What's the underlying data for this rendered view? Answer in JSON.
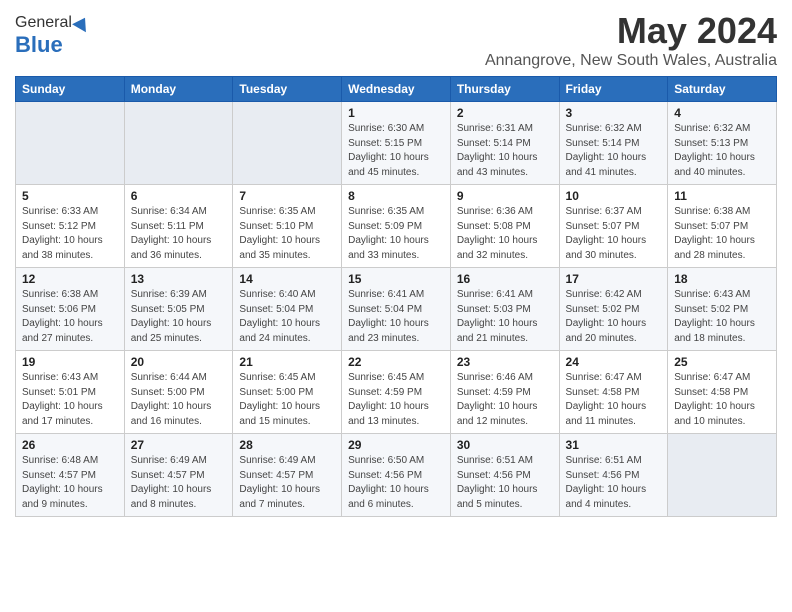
{
  "header": {
    "logo_line1": "General",
    "logo_line2": "Blue",
    "title": "May 2024",
    "subtitle": "Annangrove, New South Wales, Australia"
  },
  "days_of_week": [
    "Sunday",
    "Monday",
    "Tuesday",
    "Wednesday",
    "Thursday",
    "Friday",
    "Saturday"
  ],
  "weeks": [
    {
      "days": [
        {
          "num": "",
          "detail": "",
          "empty": true
        },
        {
          "num": "",
          "detail": "",
          "empty": true
        },
        {
          "num": "",
          "detail": "",
          "empty": true
        },
        {
          "num": "1",
          "detail": "Sunrise: 6:30 AM\nSunset: 5:15 PM\nDaylight: 10 hours\nand 45 minutes."
        },
        {
          "num": "2",
          "detail": "Sunrise: 6:31 AM\nSunset: 5:14 PM\nDaylight: 10 hours\nand 43 minutes."
        },
        {
          "num": "3",
          "detail": "Sunrise: 6:32 AM\nSunset: 5:14 PM\nDaylight: 10 hours\nand 41 minutes."
        },
        {
          "num": "4",
          "detail": "Sunrise: 6:32 AM\nSunset: 5:13 PM\nDaylight: 10 hours\nand 40 minutes."
        }
      ]
    },
    {
      "days": [
        {
          "num": "5",
          "detail": "Sunrise: 6:33 AM\nSunset: 5:12 PM\nDaylight: 10 hours\nand 38 minutes."
        },
        {
          "num": "6",
          "detail": "Sunrise: 6:34 AM\nSunset: 5:11 PM\nDaylight: 10 hours\nand 36 minutes."
        },
        {
          "num": "7",
          "detail": "Sunrise: 6:35 AM\nSunset: 5:10 PM\nDaylight: 10 hours\nand 35 minutes."
        },
        {
          "num": "8",
          "detail": "Sunrise: 6:35 AM\nSunset: 5:09 PM\nDaylight: 10 hours\nand 33 minutes."
        },
        {
          "num": "9",
          "detail": "Sunrise: 6:36 AM\nSunset: 5:08 PM\nDaylight: 10 hours\nand 32 minutes."
        },
        {
          "num": "10",
          "detail": "Sunrise: 6:37 AM\nSunset: 5:07 PM\nDaylight: 10 hours\nand 30 minutes."
        },
        {
          "num": "11",
          "detail": "Sunrise: 6:38 AM\nSunset: 5:07 PM\nDaylight: 10 hours\nand 28 minutes."
        }
      ]
    },
    {
      "days": [
        {
          "num": "12",
          "detail": "Sunrise: 6:38 AM\nSunset: 5:06 PM\nDaylight: 10 hours\nand 27 minutes."
        },
        {
          "num": "13",
          "detail": "Sunrise: 6:39 AM\nSunset: 5:05 PM\nDaylight: 10 hours\nand 25 minutes."
        },
        {
          "num": "14",
          "detail": "Sunrise: 6:40 AM\nSunset: 5:04 PM\nDaylight: 10 hours\nand 24 minutes."
        },
        {
          "num": "15",
          "detail": "Sunrise: 6:41 AM\nSunset: 5:04 PM\nDaylight: 10 hours\nand 23 minutes."
        },
        {
          "num": "16",
          "detail": "Sunrise: 6:41 AM\nSunset: 5:03 PM\nDaylight: 10 hours\nand 21 minutes."
        },
        {
          "num": "17",
          "detail": "Sunrise: 6:42 AM\nSunset: 5:02 PM\nDaylight: 10 hours\nand 20 minutes."
        },
        {
          "num": "18",
          "detail": "Sunrise: 6:43 AM\nSunset: 5:02 PM\nDaylight: 10 hours\nand 18 minutes."
        }
      ]
    },
    {
      "days": [
        {
          "num": "19",
          "detail": "Sunrise: 6:43 AM\nSunset: 5:01 PM\nDaylight: 10 hours\nand 17 minutes."
        },
        {
          "num": "20",
          "detail": "Sunrise: 6:44 AM\nSunset: 5:00 PM\nDaylight: 10 hours\nand 16 minutes."
        },
        {
          "num": "21",
          "detail": "Sunrise: 6:45 AM\nSunset: 5:00 PM\nDaylight: 10 hours\nand 15 minutes."
        },
        {
          "num": "22",
          "detail": "Sunrise: 6:45 AM\nSunset: 4:59 PM\nDaylight: 10 hours\nand 13 minutes."
        },
        {
          "num": "23",
          "detail": "Sunrise: 6:46 AM\nSunset: 4:59 PM\nDaylight: 10 hours\nand 12 minutes."
        },
        {
          "num": "24",
          "detail": "Sunrise: 6:47 AM\nSunset: 4:58 PM\nDaylight: 10 hours\nand 11 minutes."
        },
        {
          "num": "25",
          "detail": "Sunrise: 6:47 AM\nSunset: 4:58 PM\nDaylight: 10 hours\nand 10 minutes."
        }
      ]
    },
    {
      "days": [
        {
          "num": "26",
          "detail": "Sunrise: 6:48 AM\nSunset: 4:57 PM\nDaylight: 10 hours\nand 9 minutes."
        },
        {
          "num": "27",
          "detail": "Sunrise: 6:49 AM\nSunset: 4:57 PM\nDaylight: 10 hours\nand 8 minutes."
        },
        {
          "num": "28",
          "detail": "Sunrise: 6:49 AM\nSunset: 4:57 PM\nDaylight: 10 hours\nand 7 minutes."
        },
        {
          "num": "29",
          "detail": "Sunrise: 6:50 AM\nSunset: 4:56 PM\nDaylight: 10 hours\nand 6 minutes."
        },
        {
          "num": "30",
          "detail": "Sunrise: 6:51 AM\nSunset: 4:56 PM\nDaylight: 10 hours\nand 5 minutes."
        },
        {
          "num": "31",
          "detail": "Sunrise: 6:51 AM\nSunset: 4:56 PM\nDaylight: 10 hours\nand 4 minutes."
        },
        {
          "num": "",
          "detail": "",
          "empty": true
        }
      ]
    }
  ]
}
